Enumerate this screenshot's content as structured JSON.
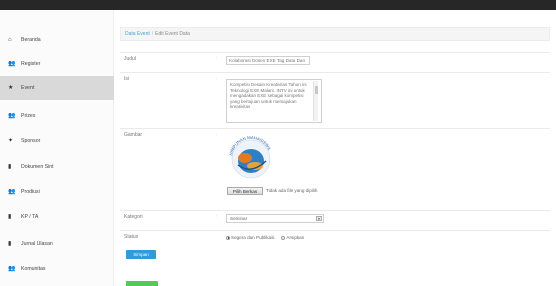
{
  "sidebar": {
    "items": [
      {
        "icon": "home-icon",
        "glyph": "⌂",
        "label": "Beranda",
        "active": false
      },
      {
        "icon": "users-icon",
        "glyph": "👥",
        "label": "Register",
        "active": false
      },
      {
        "icon": "event-icon",
        "glyph": "★",
        "label": "Event",
        "active": true
      },
      {
        "icon": "prizes-icon",
        "glyph": "👥",
        "label": "Prizes",
        "active": false
      },
      {
        "icon": "sponsor-icon",
        "glyph": "✦",
        "label": "Sponsor",
        "active": false
      },
      {
        "icon": "pdf-icon",
        "glyph": "▮",
        "label": "Dokumen Sint",
        "active": false
      },
      {
        "icon": "prodiusi-icon",
        "glyph": "👥",
        "label": "Prodiusi",
        "active": false
      },
      {
        "icon": "kprita-icon",
        "glyph": "▮",
        "label": "KP / TA",
        "active": false
      },
      {
        "icon": "jurnal-icon",
        "glyph": "▮",
        "label": "Jurnal Ulasan",
        "active": false
      },
      {
        "icon": "komunitas-icon",
        "glyph": "👥",
        "label": "Komunitas",
        "active": false
      }
    ]
  },
  "breadcrumb": {
    "link": "Data Event",
    "separator": "/",
    "current": "Edit Event Data"
  },
  "form": {
    "judul": {
      "label": "Judul",
      "value": "Kolaborasi Dosen EXE Tag Data Dan"
    },
    "isi": {
      "label": "Isi",
      "value": "Kompetisi Desain Kreativitas Tahun ini Teknologi EXE Malam. INTV ini untuk mengadakan EXE sebagai kompetisi yang bertujuan untuk memajukan kreativitas"
    },
    "gambar": {
      "label": "Gambar",
      "logo_text": "HIMPUNAN MAHASISWA",
      "file_button": "Pilih Berkas",
      "file_status": "Tidak ada file yang dipilih"
    },
    "kategori": {
      "label": "Kategori",
      "value": "Seminar"
    },
    "status": {
      "label": "Status",
      "options": [
        {
          "label": "Segera dan Publikasi",
          "checked": true
        },
        {
          "label": "Arsipkan",
          "checked": false
        }
      ]
    },
    "submit": "Simpan"
  },
  "colors": {
    "accent": "#2f9bd8",
    "active_nav": "#d9d9d9",
    "link": "#42a5d6",
    "green": "#55c85a",
    "topbar": "#272727"
  }
}
